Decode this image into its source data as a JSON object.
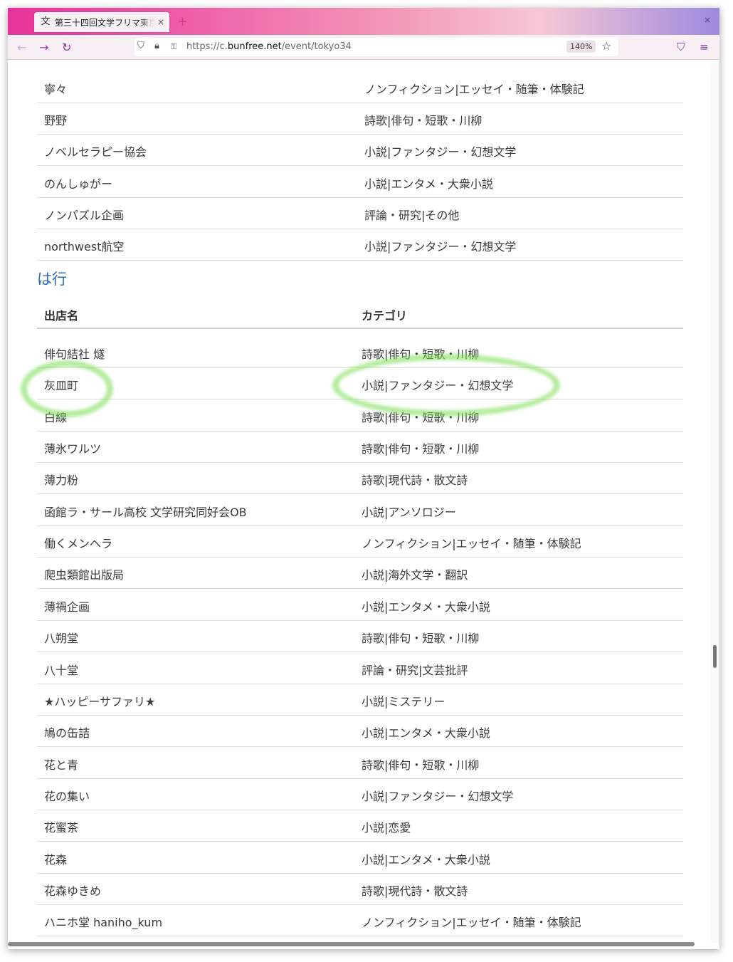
{
  "browser": {
    "tab_title": "第三十四回文学フリマ東京",
    "tab_icon": "文",
    "tab_close": "×",
    "new_tab": "+",
    "window_close": "×",
    "url_prefix": "https://c.",
    "url_domain": "bunfree.net",
    "url_path": "/event/tokyo34",
    "zoom": "140%"
  },
  "table_top": {
    "rows": [
      {
        "name": "寧々",
        "category": "ノンフィクション|エッセイ・随筆・体験記"
      },
      {
        "name": "野野",
        "category": "詩歌|俳句・短歌・川柳"
      },
      {
        "name": "ノベルセラピー協会",
        "category": "小説|ファンタジー・幻想文学"
      },
      {
        "name": "のんしゅがー",
        "category": "小説|エンタメ・大衆小説"
      },
      {
        "name": "ノンパズル企画",
        "category": "評論・研究|その他"
      },
      {
        "name": "northwest航空",
        "category": "小説|ファンタジー・幻想文学"
      }
    ]
  },
  "section_ha": {
    "heading": "は行",
    "col_name": "出店名",
    "col_category": "カテゴリ",
    "rows": [
      {
        "name": "俳句結社 燧",
        "category": "詩歌|俳句・短歌・川柳"
      },
      {
        "name": "灰皿町",
        "category": "小説|ファンタジー・幻想文学"
      },
      {
        "name": "白線",
        "category": "詩歌|俳句・短歌・川柳"
      },
      {
        "name": "薄氷ワルツ",
        "category": "詩歌|俳句・短歌・川柳"
      },
      {
        "name": "薄力粉",
        "category": "詩歌|現代詩・散文詩"
      },
      {
        "name": "函館ラ・サール高校 文学研究同好会OB",
        "category": "小説|アンソロジー"
      },
      {
        "name": "働くメンヘラ",
        "category": "ノンフィクション|エッセイ・随筆・体験記"
      },
      {
        "name": "爬虫類館出版局",
        "category": "小説|海外文学・翻訳"
      },
      {
        "name": "薄禍企画",
        "category": "小説|エンタメ・大衆小説"
      },
      {
        "name": "八朔堂",
        "category": "詩歌|俳句・短歌・川柳"
      },
      {
        "name": "八十堂",
        "category": "評論・研究|文芸批評"
      },
      {
        "name": "★ハッピーサファリ★",
        "category": "小説|ミステリー"
      },
      {
        "name": "鳩の缶詰",
        "category": "小説|エンタメ・大衆小説"
      },
      {
        "name": "花と青",
        "category": "詩歌|俳句・短歌・川柳"
      },
      {
        "name": "花の集い",
        "category": "小説|ファンタジー・幻想文学"
      },
      {
        "name": "花蜜茶",
        "category": "小説|恋愛"
      },
      {
        "name": "花森",
        "category": "小説|エンタメ・大衆小説"
      },
      {
        "name": "花森ゆきめ",
        "category": "詩歌|現代詩・散文詩"
      },
      {
        "name": "ハニホ堂 haniho_kum",
        "category": "ノンフィクション|エッセイ・随筆・体験記"
      }
    ]
  }
}
